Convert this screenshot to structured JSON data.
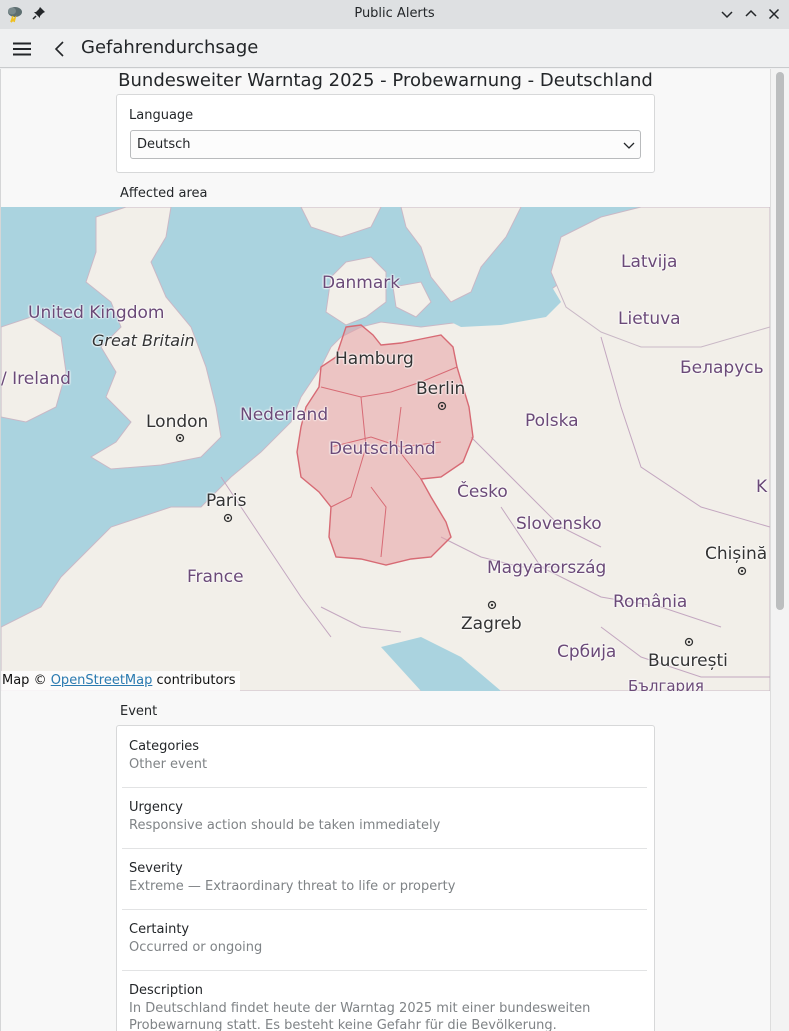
{
  "window": {
    "title": "Public Alerts"
  },
  "toolbar": {
    "heading": "Gefahrendurchsage"
  },
  "alert": {
    "title": "Bundesweiter Warntag 2025 - Probewarnung - Deutschland"
  },
  "language": {
    "label": "Language",
    "selected": "Deutsch"
  },
  "area": {
    "label": "Affected area"
  },
  "map": {
    "attribution_prefix": "Map © ",
    "attribution_link": "OpenStreetMap",
    "attribution_suffix": " contributors",
    "labels": {
      "danmark": "Danmark",
      "latvija": "Latvija",
      "united_kingdom": "United Kingdom",
      "great_britain": "Great Britain",
      "lietuva": "Lietuva",
      "hamburg": "Hamburg",
      "belarus": "Беларусь",
      "ireland": "/ Ireland",
      "berlin": "Berlin",
      "london": "London",
      "nederland": "Nederland",
      "polska": "Polska",
      "deutschland": "Deutschland",
      "paris": "Paris",
      "cesko": "Česko",
      "k": "K",
      "slovensko": "Slovensko",
      "chisinau": "Chișină",
      "france": "France",
      "magyarorszag": "Magyarország",
      "romania": "România",
      "zagreb": "Zagreb",
      "srbija": "Србија",
      "bucuresti": "București",
      "bulgaria": "България"
    },
    "colors": {
      "sea": "#aad3df",
      "land": "#f2efe9",
      "highlight": "#e8a0a4"
    }
  },
  "event": {
    "label": "Event",
    "rows": [
      {
        "key": "Categories",
        "value": "Other event"
      },
      {
        "key": "Urgency",
        "value": "Responsive action should be taken immediately"
      },
      {
        "key": "Severity",
        "value": "Extreme — Extraordinary threat to life or property"
      },
      {
        "key": "Certainty",
        "value": "Occurred or ongoing"
      },
      {
        "key": "Description",
        "value": "In Deutschland findet heute der Warntag 2025 mit einer bundesweiten Probewarnung statt. Es besteht keine Gefahr für die Bevölkerung."
      }
    ]
  }
}
